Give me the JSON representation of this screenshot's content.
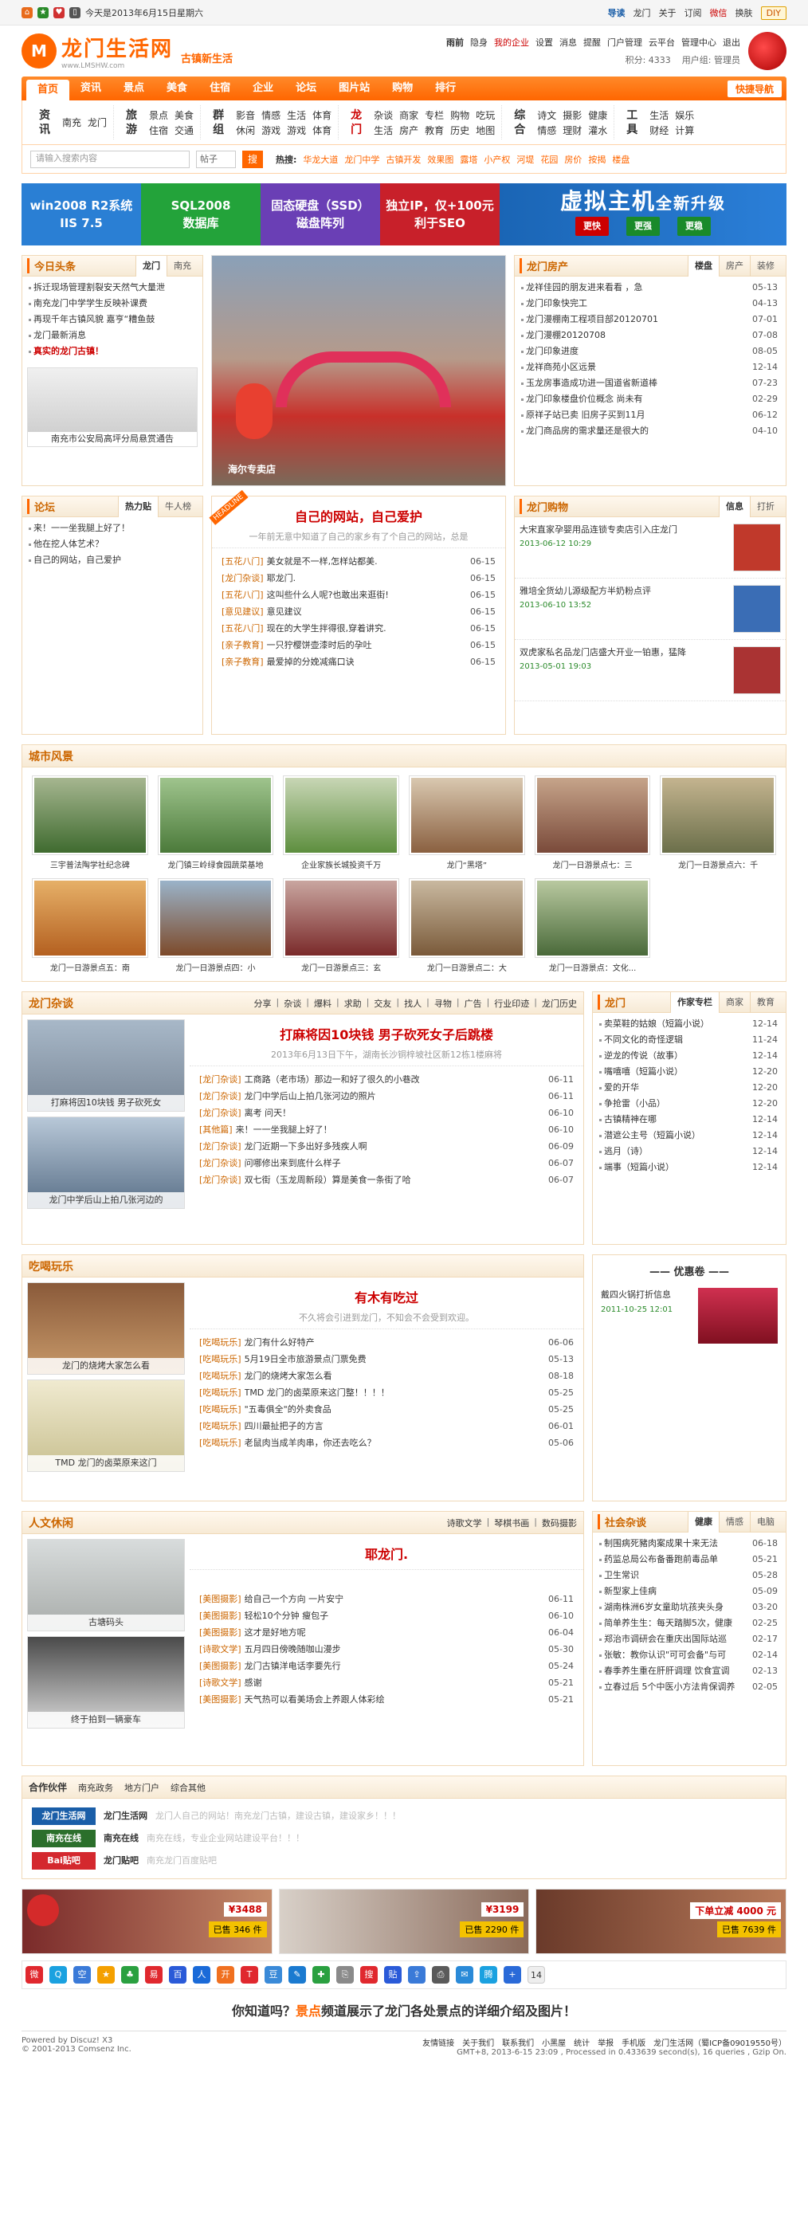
{
  "topbar": {
    "date": "今天是2013年6月15日星期六",
    "links": [
      "导读",
      "龙门",
      "关于",
      "订阅",
      "微信",
      "换肤",
      "DIY"
    ]
  },
  "header": {
    "logo_mark": "M",
    "logo_text": "龙门生活网",
    "logo_url": "www.LMSHW.com",
    "slogan": "古镇新生活",
    "user_links": [
      "雨前",
      "隐身",
      "我的企业",
      "设置",
      "消息",
      "提醒",
      "门户管理",
      "云平台",
      "管理中心",
      "退出"
    ],
    "points": "积分: 4333",
    "group": "用户组: 管理员"
  },
  "nav": {
    "items": [
      "首页",
      "资讯",
      "景点",
      "美食",
      "住宿",
      "企业",
      "论坛",
      "图片站",
      "购物",
      "排行"
    ],
    "quick": "快捷导航"
  },
  "subnav": [
    {
      "title": "资讯",
      "red": false,
      "cols": 2,
      "links": [
        "南充",
        "龙门"
      ]
    },
    {
      "title": "旅游",
      "red": false,
      "cols": 2,
      "links": [
        "景点",
        "美食",
        "住宿",
        "交通"
      ]
    },
    {
      "title": "群组",
      "red": false,
      "cols": 4,
      "links": [
        "影音",
        "情感",
        "生活",
        "体育",
        "休闲",
        "游戏",
        "游戏",
        "体育"
      ]
    },
    {
      "title": "龙门",
      "red": true,
      "cols": 5,
      "links": [
        "杂谈",
        "商家",
        "专栏",
        "购物",
        "吃玩",
        "生活",
        "房产",
        "教育",
        "历史",
        "地图"
      ]
    },
    {
      "title": "综合",
      "red": false,
      "cols": 3,
      "links": [
        "诗文",
        "摄影",
        "健康",
        "情感",
        "理财",
        "灌水"
      ]
    },
    {
      "title": "工具",
      "red": false,
      "cols": 2,
      "links": [
        "生活",
        "娱乐",
        "财经",
        "计算"
      ]
    }
  ],
  "search": {
    "placeholder": "请输入搜索内容",
    "scope": "帖子",
    "button": "搜",
    "hot_label": "热搜:",
    "hot": [
      "华龙大道",
      "龙门中学",
      "古镇开发",
      "效果图",
      "露塔",
      "小产权",
      "河堤",
      "花园",
      "房价",
      "按揭",
      "楼盘"
    ]
  },
  "banners": [
    {
      "line1": "win2008 R2系统",
      "line2": "IIS 7.5",
      "color": "#2a7fd4"
    },
    {
      "line1": "SQL2008",
      "line2": "数据库",
      "color": "#23a33a"
    },
    {
      "line1": "固态硬盘（SSD）",
      "line2": "磁盘阵列",
      "color": "#6a3fb5"
    },
    {
      "line1": "独立IP，仅+100元",
      "line2": "利于SEO",
      "color": "#c8202a"
    }
  ],
  "banner_big": {
    "main": "虚拟主机",
    "sub": "全新升级",
    "btns": [
      "更快",
      "更强",
      "更稳"
    ]
  },
  "today": {
    "title": "今日头条",
    "tabs": [
      "龙门",
      "南充"
    ],
    "items": [
      "拆迁现场管理割裂安天然气大量泄",
      "南充龙门中学学生反映补课费",
      "再现千年古镇风貌 嘉亨“糟鱼鼓",
      "龙门最新消息",
      "真实的龙门古镇！"
    ],
    "photo_caption": "南充市公安局高坪分局悬赏通告"
  },
  "slide_caption": "海尔专卖店",
  "house": {
    "title": "龙门房产",
    "tabs": [
      "楼盘",
      "房产",
      "装修"
    ],
    "items": [
      [
        "龙祥佳园的朋友进来看看 ，急",
        "05-13"
      ],
      [
        "龙门印象快完工",
        "04-13"
      ],
      [
        "龙门漫棚南工程项目部20120701",
        "07-01"
      ],
      [
        "龙门漫棚20120708",
        "07-08"
      ],
      [
        "龙门印象进度",
        "08-05"
      ],
      [
        "龙祥商苑小区远景",
        "12-14"
      ],
      [
        "玉龙房事造成功进一国道省新道棒",
        "07-23"
      ],
      [
        "龙门印象楼盘价位概念 尚未有",
        "02-29"
      ],
      [
        "原祥子站已卖 旧房子买到11月",
        "06-12"
      ],
      [
        "龙门商品房的需求量还是很大的",
        "04-10"
      ]
    ]
  },
  "forum": {
    "title": "论坛",
    "tabs": [
      "热力贴",
      "牛人榜"
    ],
    "items": [
      "来！一一坐我腿上好了！",
      "他在挖人体艺术？",
      "自己的网站，自己爱护"
    ]
  },
  "headline": {
    "ribbon": "HEADLINE",
    "title": "自己的网站，自己爱护",
    "sub": "一年前无意中知道了自己的家乡有了个自己的网站，总是",
    "items": [
      [
        "[五花八门]",
        "美女就是不一样,怎样站都美.",
        "06-15"
      ],
      [
        "[龙门杂谈]",
        "耶龙门.",
        "06-15"
      ],
      [
        "[五花八门]",
        "这叫些什么人呢?也敢出来逛街!",
        "06-15"
      ],
      [
        "[意见建议]",
        "意见建议",
        "06-15"
      ],
      [
        "[五花八门]",
        "现在的大学生拌得很,穿着讲究.",
        "06-15"
      ],
      [
        "[亲子教育]",
        "一只狞樱饼壶漆时后的孕吐",
        "06-15"
      ],
      [
        "[亲子教育]",
        "最爱掉的分娩减痛口诀",
        "06-15"
      ]
    ]
  },
  "shop": {
    "title": "龙门购物",
    "tabs": [
      "信息",
      "打折"
    ],
    "items": [
      {
        "text": "大宋直家孕婴用品连锁专卖店引入庄龙门",
        "date": "2013-06-12 10:29",
        "color": "#c0392b"
      },
      {
        "text": "雅培全货幼儿源级配方半奶粉点评",
        "date": "2013-06-10 13:52",
        "color": "#3a6db5"
      },
      {
        "text": "双虎家私名品龙门店盛大开业一铂惠，猛降",
        "date": "2013-05-01 19:03",
        "color": "#a33"
      }
    ]
  },
  "city": {
    "title": "城市风景",
    "items": [
      {
        "cap": "三宇普法陶学社纪念碑",
        "c1": "#3f6b2f",
        "c2": "#a6b690"
      },
      {
        "cap": "龙门镇三岭绿食园蔬菜基地",
        "c1": "#4b7a3a",
        "c2": "#9fc48d"
      },
      {
        "cap": "企业家族长城投资千万",
        "c1": "#5d8e3e",
        "c2": "#c8d6b5"
      },
      {
        "cap": "龙门“黑塔”",
        "c1": "#8a6040",
        "c2": "#d9c8b0"
      },
      {
        "cap": "龙门一日游景点七：三",
        "c1": "#7a4a3a",
        "c2": "#c6a48a"
      },
      {
        "cap": "龙门一日游景点六：千",
        "c1": "#6b6f4a",
        "c2": "#c4b48f"
      },
      {
        "cap": "龙门一日游景点五：南",
        "c1": "#b46020",
        "c2": "#e6b068"
      },
      {
        "cap": "龙门一日游景点四：小",
        "c1": "#7d4a2a",
        "c2": "#9ab3c9"
      },
      {
        "cap": "龙门一日游景点三：玄",
        "c1": "#7a2a2a",
        "c2": "#c9a6a0"
      },
      {
        "cap": "龙门一日游景点二：大",
        "c1": "#7a5a3a",
        "c2": "#c9b9a0"
      },
      {
        "cap": "龙门一日游景点：文化...",
        "c1": "#4a6a3a",
        "c2": "#b9c9a0"
      }
    ]
  },
  "chat": {
    "title": "龙门杂谈",
    "links": [
      "分享",
      "杂谈",
      "爆料",
      "求助",
      "交友",
      "找人",
      "寻物",
      "广告",
      "行业印迹",
      "龙门历史"
    ],
    "pics": [
      "打麻将因10块钱 男子砍死女",
      "龙门中学后山上拍几张河边的"
    ],
    "feature": "打麻将因10块钱 男子砍死女子后跳楼",
    "feature_sub": "2013年6月13日下午，湖南长沙铜梓坡社区新12栋1楼麻将",
    "items": [
      [
        "[龙门杂谈]",
        "工商路（老市场）那边一和好了很久的小巷改",
        "06-11"
      ],
      [
        "[龙门杂谈]",
        "龙门中学后山上拍几张河边的照片",
        "06-11"
      ],
      [
        "[龙门杂谈]",
        "离考 问天！",
        "06-10"
      ],
      [
        "[其他篇]",
        "来！一一坐我腿上好了！",
        "06-10"
      ],
      [
        "[龙门杂谈]",
        "龙门近期一下多出好多残疾人啊",
        "06-09"
      ],
      [
        "[龙门杂谈]",
        "问哪修出来到底什么样子",
        "06-07"
      ],
      [
        "[龙门杂谈]",
        "双七街（玉龙周新段）算是美食一条街了哈",
        "06-07"
      ]
    ],
    "side_title": "龙门",
    "side_tabs": [
      "作家专栏",
      "商家",
      "教育"
    ],
    "side_items": [
      [
        "卖菜鞋的姑娘（短篇小说）",
        "12-14"
      ],
      [
        "不同文化的奇怪逻辑",
        "11-24"
      ],
      [
        "逆龙的传说（故事）",
        "12-14"
      ],
      [
        "嘴嘻嘻（短篇小说）",
        "12-20"
      ],
      [
        "爱的开华",
        "12-20"
      ],
      [
        "争抢雷（小品）",
        "12-20"
      ],
      [
        "古镇精神在哪",
        "12-14"
      ],
      [
        "潜遮公主号（短篇小说）",
        "12-14"
      ],
      [
        "逃月（诗）",
        "12-14"
      ],
      [
        "端事（短篇小说）",
        "12-14"
      ]
    ]
  },
  "food": {
    "title": "吃喝玩乐",
    "pics": [
      "龙门的烧烤大家怎么看",
      "TMD 龙门的卤菜原来这门"
    ],
    "feature": "有木有吃过",
    "feature_sub": "不久将会引进到龙门，不知会不会受到欢迎。",
    "items": [
      [
        "[吃喝玩乐]",
        "龙门有什么好特产",
        "06-06"
      ],
      [
        "[吃喝玩乐]",
        "5月19日全市旅游景点门票免费",
        "05-13"
      ],
      [
        "[吃喝玩乐]",
        "龙门的烧烤大家怎么看",
        "08-18"
      ],
      [
        "[吃喝玩乐]",
        "TMD 龙门的卤菜原来这门整！！！！",
        "05-25"
      ],
      [
        "[吃喝玩乐]",
        "\"五毒俱全\"的外卖食品",
        "05-25"
      ],
      [
        "[吃喝玩乐]",
        "四川最扯把子的方言",
        "06-01"
      ],
      [
        "[吃喝玩乐]",
        "老鼠肉当成羊肉串，你还去吃么？",
        "05-06"
      ]
    ],
    "coupon_title": "—— 优惠卷 ——",
    "coupon_text": "戴四火锅打折信息",
    "coupon_date": "2011-10-25 12:01"
  },
  "human": {
    "title": "人文休闲",
    "links": [
      "诗歌文学",
      "琴棋书画",
      "数码摄影"
    ],
    "pics": [
      "古塘码头",
      "终于拍到一辆豪车"
    ],
    "feature": "耶龙门.",
    "items": [
      [
        "[美图摄影]",
        "给自己一个方向 一片安宁",
        "06-11"
      ],
      [
        "[美图摄影]",
        "轻松10个分钟 瘦包子",
        "06-10"
      ],
      [
        "[美图摄影]",
        "这才是好地方呢",
        "06-04"
      ],
      [
        "[诗歌文学]",
        "五月四日傍晚随咖山漫步",
        "05-30"
      ],
      [
        "[美图摄影]",
        "龙门古镇洋电话李要先行",
        "05-24"
      ],
      [
        "[诗歌文学]",
        "感谢",
        "05-21"
      ],
      [
        "[美图摄影]",
        "天气热可以看美场会上养跟人体彩绘",
        "05-21"
      ]
    ],
    "side_title": "社会杂谈",
    "side_tabs": [
      "健康",
      "情感",
      "电脑"
    ],
    "side_items": [
      [
        "制围病死豬肉案成果十来无法",
        "06-18"
      ],
      [
        "药监总局公布备番跑前毒品单",
        "05-21"
      ],
      [
        "卫生常识",
        "05-28"
      ],
      [
        "新型家上佳病",
        "05-09"
      ],
      [
        "湖南株洲6岁女童助坑孩夹头身",
        "03-20"
      ],
      [
        "简单养生生：每天踏脚5次，健康",
        "02-25"
      ],
      [
        "郑治市调研会在重庆出国际站巡",
        "02-17"
      ],
      [
        "张敏：教你认识\"可可会备\"与可",
        "02-14"
      ],
      [
        "春季养生重在肝肝调理 饮食宣调",
        "02-13"
      ],
      [
        "立春过后 5个中医小方法肯保调养",
        "02-05"
      ]
    ]
  },
  "partners": {
    "tabs": [
      "合作伙伴",
      "南充政务",
      "地方门户",
      "综合其他"
    ],
    "items": [
      {
        "logo": "龙门生活网",
        "name": "龙门生活网",
        "desc": "龙门人自己的网站！南充龙门古镇，建设古镇，建设家乡！！！",
        "color": "#1a5ea8"
      },
      {
        "logo": "南充在线",
        "name": "南充在线",
        "desc": "南充在线，专业企业网站建设平台！！！",
        "color": "#2b6f2b"
      },
      {
        "logo": "Bai贴吧",
        "name": "龙门贴吧",
        "desc": "南充龙门百度贴吧",
        "color": "#d4282e"
      }
    ]
  },
  "ads": [
    {
      "price": "¥3488",
      "sold": "已售 346 件"
    },
    {
      "price": "¥3199",
      "sold": "已售 2290 件"
    },
    {
      "price": "下单立减 4000 元",
      "sold": "已售 7639 件"
    }
  ],
  "share_count": "14",
  "know": {
    "pre": "你知道吗？",
    "key": "景点",
    "post": "频道展示了龙门各处景点的详细介绍及图片！"
  },
  "footer": {
    "left": "Powered by Discuz! X3",
    "left2": "© 2001-2013 Comsenz Inc.",
    "links": [
      "友情链接",
      "关于我们",
      "联系我们",
      "小黑屋",
      "统计",
      "举报",
      "手机版",
      "龙门生活网（蜀ICP备09019550号）"
    ],
    "right2": "GMT+8, 2013-6-15 23:09 , Processed in 0.433639 second(s), 16 queries , Gzip On."
  }
}
